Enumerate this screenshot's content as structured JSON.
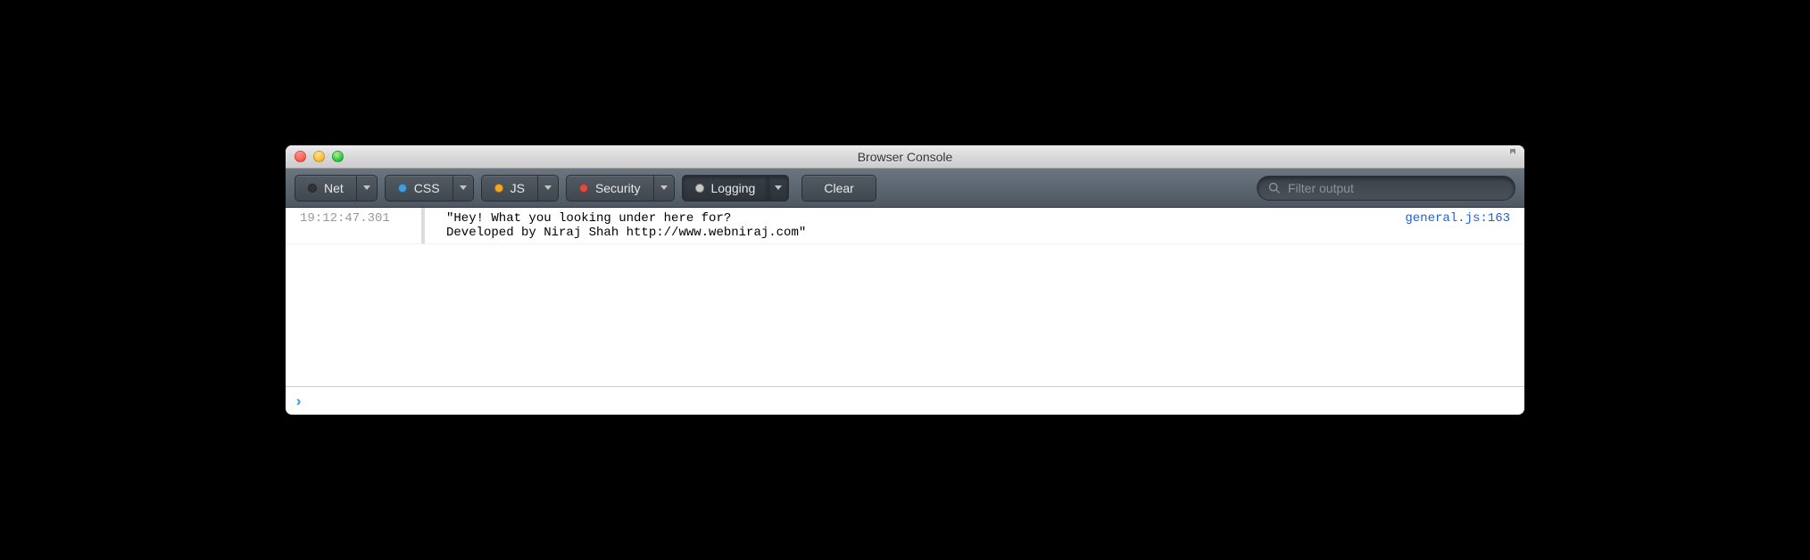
{
  "window": {
    "title": "Browser Console"
  },
  "toolbar": {
    "filters": [
      {
        "label": "Net",
        "dot": "dot-dark",
        "active": false
      },
      {
        "label": "CSS",
        "dot": "dot-blue",
        "active": false
      },
      {
        "label": "JS",
        "dot": "dot-orange",
        "active": false
      },
      {
        "label": "Security",
        "dot": "dot-red",
        "active": false
      },
      {
        "label": "Logging",
        "dot": "dot-gray",
        "active": true
      }
    ],
    "clear_label": "Clear",
    "search_placeholder": "Filter output"
  },
  "log": {
    "timestamp": "19:12:47.301",
    "message": "\"Hey! What you looking under here for?\nDeveloped by Niraj Shah http://www.webniraj.com\"",
    "source": "general.js:163"
  }
}
